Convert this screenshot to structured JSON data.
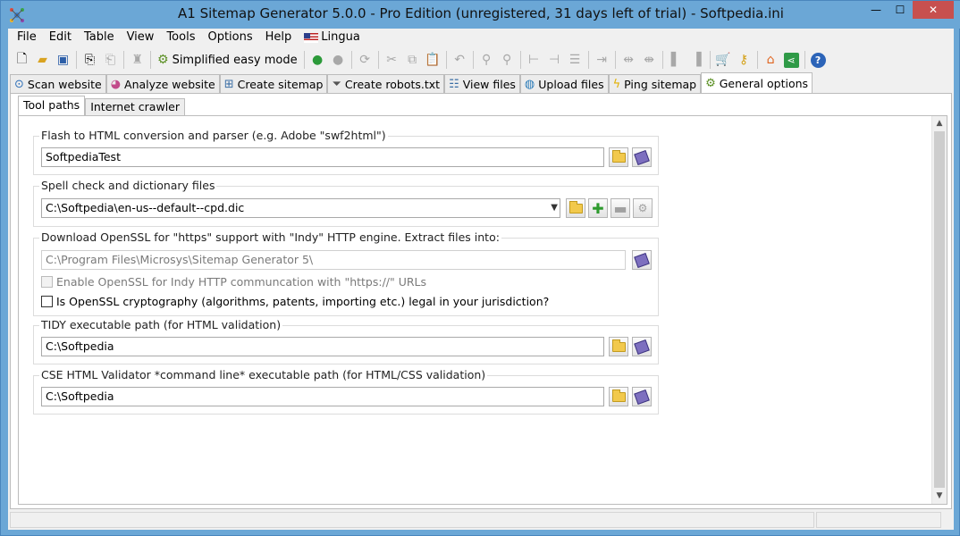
{
  "window": {
    "title": "A1 Sitemap Generator 5.0.0 - Pro Edition (unregistered, 31 days left of trial) - Softpedia.ini",
    "controls": {
      "minimize": "—",
      "maximize": "☐",
      "close": "✕"
    }
  },
  "menu": {
    "items": [
      "File",
      "Edit",
      "Table",
      "View",
      "Tools",
      "Options",
      "Help"
    ],
    "lingua": "Lingua"
  },
  "toolbar": {
    "simplified_mode_label": "Simplified easy mode"
  },
  "tabs": [
    {
      "label": "Scan website",
      "icon": "magnifier-icon"
    },
    {
      "label": "Analyze website",
      "icon": "chart-icon"
    },
    {
      "label": "Create sitemap",
      "icon": "sitemap-icon"
    },
    {
      "label": "Create robots.txt",
      "icon": "filter-icon"
    },
    {
      "label": "View files",
      "icon": "list-icon"
    },
    {
      "label": "Upload files",
      "icon": "globe-icon"
    },
    {
      "label": "Ping sitemap",
      "icon": "bolt-icon"
    },
    {
      "label": "General options",
      "icon": "gears-icon",
      "active": true
    }
  ],
  "subtabs": [
    {
      "label": "Tool paths",
      "active": true
    },
    {
      "label": "Internet crawler"
    }
  ],
  "groups": {
    "flash": {
      "label": "Flash to HTML conversion and parser (e.g. Adobe \"swf2html\")",
      "value": "SoftpediaTest"
    },
    "spell": {
      "label": "Spell check and dictionary files",
      "value": "C:\\Softpedia\\en-us--default--cpd.dic"
    },
    "openssl": {
      "label": "Download OpenSSL for \"https\" support with \"Indy\" HTTP engine. Extract files into:",
      "value": "C:\\Program Files\\Microsys\\Sitemap Generator 5\\",
      "enable_label": "Enable OpenSSL for Indy HTTP communcation with \"https://\" URLs",
      "legal_label": "Is OpenSSL cryptography (algorithms, patents, importing etc.) legal in your jurisdiction?"
    },
    "tidy": {
      "label": "TIDY executable path (for HTML validation)",
      "value": "C:\\Softpedia"
    },
    "cse": {
      "label": "CSE HTML Validator *command line* executable path (for HTML/CSS validation)",
      "value": "C:\\Softpedia"
    }
  }
}
